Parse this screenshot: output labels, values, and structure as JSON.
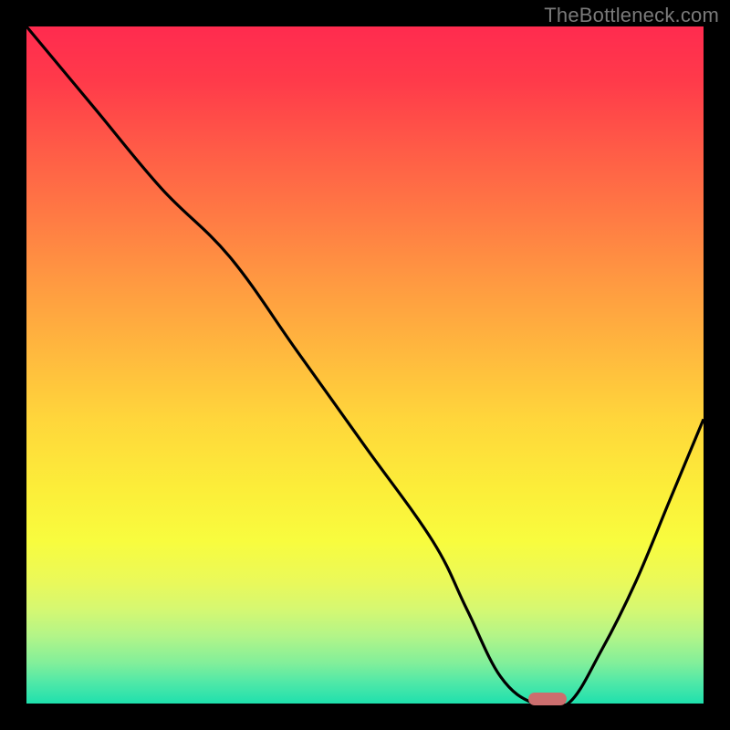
{
  "watermark": "TheBottleneck.com",
  "colors": {
    "curve_stroke": "#000000",
    "marker_fill": "#cc6e6e"
  },
  "chart_data": {
    "type": "line",
    "title": "",
    "xlabel": "",
    "ylabel": "",
    "xlim": [
      0,
      100
    ],
    "ylim": [
      0,
      100
    ],
    "grid": false,
    "legend": false,
    "annotations": [],
    "series": [
      {
        "name": "bottleneck-curve",
        "x": [
          0,
          10,
          20,
          30,
          40,
          50,
          60,
          65,
          70,
          75,
          80,
          85,
          90,
          95,
          100
        ],
        "y": [
          100,
          88,
          76,
          66,
          52,
          38,
          24,
          14,
          4,
          0,
          0,
          8,
          18,
          30,
          42
        ]
      }
    ],
    "optimal_marker": {
      "x": 77,
      "y": 0
    }
  }
}
